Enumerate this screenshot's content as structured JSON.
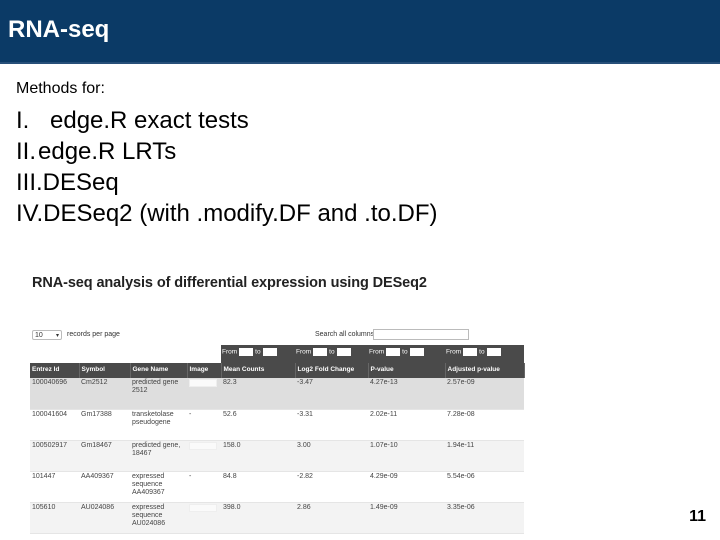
{
  "title": "RNA-seq",
  "methods_label": "Methods for:",
  "methods": [
    {
      "num": "I.",
      "text": "edge.R exact tests"
    },
    {
      "num": "II.",
      "text": "edge.R LRTs"
    },
    {
      "num": "III.",
      "text": "DESeq"
    },
    {
      "num": "IV.",
      "text": "DESeq2 (with .modify.DF and .to.DF)"
    }
  ],
  "screenshot": {
    "title": "RNA-seq analysis of differential expression using DESeq2",
    "page_size": "10",
    "records_per_page": "records per page",
    "search_label": "Search all columns:",
    "filter_from": "From",
    "filter_to": "to",
    "columns": [
      "Entrez Id",
      "Symbol",
      "Gene Name",
      "Image",
      "Mean Counts",
      "Log2 Fold Change",
      "P-value",
      "Adjusted p-value"
    ],
    "rows": [
      {
        "entrez": "100040696",
        "symbol": "Cm2512",
        "gene_name": "predicted gene 2512",
        "image": "",
        "mean": "82.3",
        "log2fc": "-3.47",
        "pval": "4.27e-13",
        "padj": "2.57e-09"
      },
      {
        "entrez": "100041604",
        "symbol": "Gm17388",
        "gene_name": "transketolase pseudogene",
        "image": "-",
        "mean": "52.6",
        "log2fc": "-3.31",
        "pval": "2.02e-11",
        "padj": "7.28e-08"
      },
      {
        "entrez": "100502917",
        "symbol": "Gm18467",
        "gene_name": "predicted gene, 18467",
        "image": "",
        "mean": "158.0",
        "log2fc": "3.00",
        "pval": "1.07e-10",
        "padj": "1.94e-11"
      },
      {
        "entrez": "101447",
        "symbol": "AA409367",
        "gene_name": "expressed sequence AA409367",
        "image": "-",
        "mean": "84.8",
        "log2fc": "-2.82",
        "pval": "4.29e-09",
        "padj": "5.54e-06"
      },
      {
        "entrez": "105610",
        "symbol": "AU024086",
        "gene_name": "expressed sequence AU024086",
        "image": "",
        "mean": "398.0",
        "log2fc": "2.86",
        "pval": "1.49e-09",
        "padj": "3.35e-06"
      }
    ]
  },
  "page_number": "11",
  "colors": {
    "title_bar": "#0b3a66",
    "table_header": "#4a4a4a",
    "link": "#2a6ebb"
  }
}
